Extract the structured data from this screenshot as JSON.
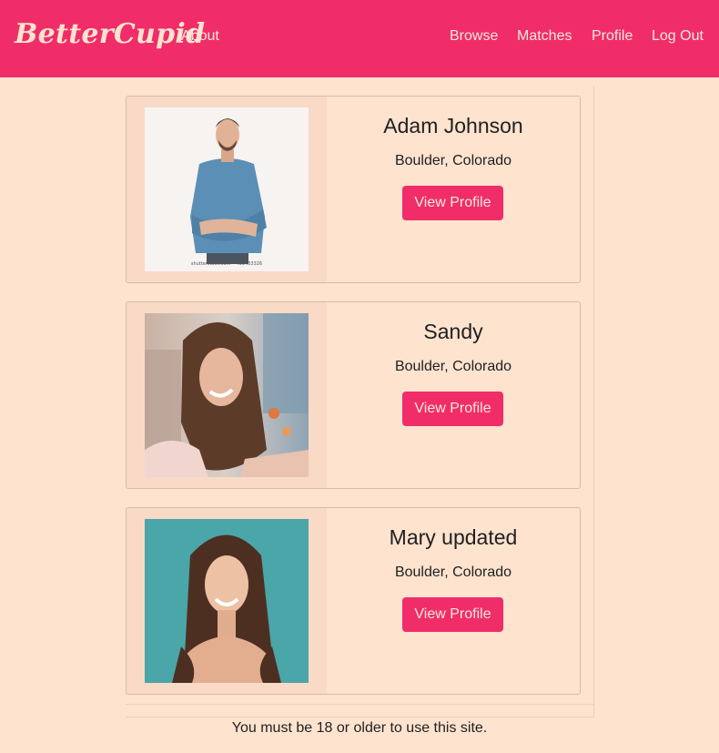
{
  "brand": {
    "name": "BetterCupid"
  },
  "nav": {
    "about": "About",
    "browse": "Browse",
    "matches": "Matches",
    "profile": "Profile",
    "logout": "Log Out"
  },
  "profiles": [
    {
      "name": "Adam Johnson",
      "location": "Boulder, Colorado",
      "button": "View Profile",
      "photo_caption": "shutterstock.com • 439433326"
    },
    {
      "name": "Sandy",
      "location": "Boulder, Colorado",
      "button": "View Profile"
    },
    {
      "name": "Mary updated",
      "location": "Boulder, Colorado",
      "button": "View Profile"
    }
  ],
  "footer": {
    "notice": "You must be 18 or older to use this site."
  },
  "colors": {
    "accent": "#f02d69",
    "background": "#fee3cf",
    "card_left": "#f8dac6"
  }
}
